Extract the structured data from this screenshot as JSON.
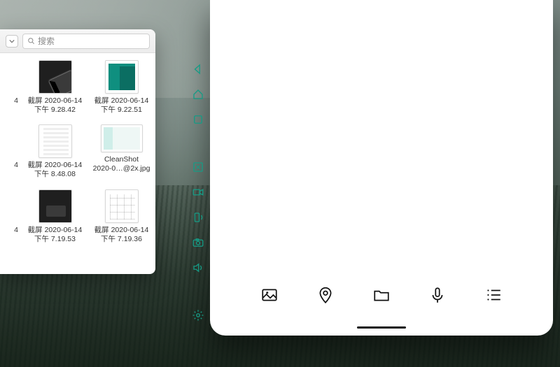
{
  "finder": {
    "search_placeholder": "搜索",
    "edge_labels": [
      "4",
      "4",
      "4"
    ],
    "files": [
      {
        "name_l1": "截屏 2020-06-14",
        "name_l2": "下午 9.28.42",
        "thumb": "dark cursor"
      },
      {
        "name_l1": "截屏 2020-06-14",
        "name_l2": "下午 9.22.51",
        "thumb": "teal-doc"
      },
      {
        "name_l1": "截屏 2020-06-14",
        "name_l2": "下午 8.48.08",
        "thumb": "light-doc"
      },
      {
        "name_l1": "CleanShot",
        "name_l2": "2020-0…@2x.jpg",
        "thumb": "wide-doc"
      },
      {
        "name_l1": "截屏 2020-06-14",
        "name_l2": "下午 7.19.53",
        "thumb": "dark"
      },
      {
        "name_l1": "截屏 2020-06-14",
        "name_l2": "下午 7.19.36",
        "thumb": "grid-doc"
      }
    ]
  },
  "emulator_toolbar": {
    "items": [
      "back",
      "home",
      "recents",
      "screenshot",
      "record",
      "rotate",
      "camera",
      "volume",
      "settings"
    ]
  },
  "phone_actions": {
    "items": [
      "image",
      "location",
      "folder",
      "mic",
      "list"
    ]
  },
  "colors": {
    "accent_teal": "#169b85"
  }
}
